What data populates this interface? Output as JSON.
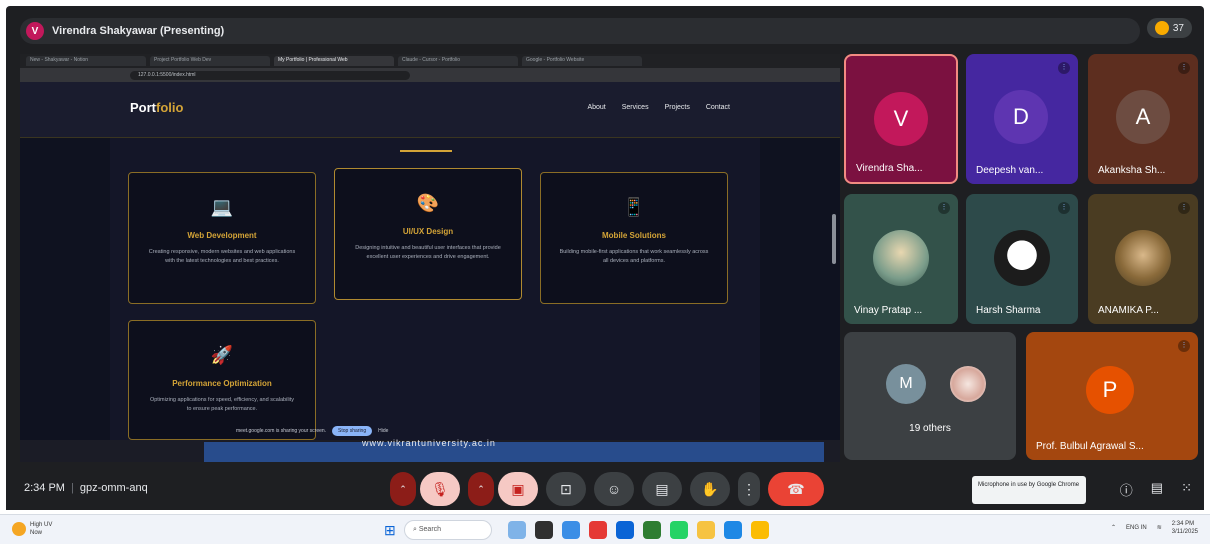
{
  "meet": {
    "presenter_initial": "V",
    "presenter_title": "Virendra Shakyawar (Presenting)",
    "participant_count": "37",
    "time": "2:34 PM",
    "meeting_code": "gpz-omm-anq",
    "mic_toast": "Microphone in use by Google Chrome"
  },
  "shared_screen": {
    "tabs": [
      "New - Shakyawar - Notion",
      "Project Portfolio Web Dev",
      "My Portfolio | Professional Web",
      "Claude - Cursor - Portfolio",
      "Google - Portfolio Website"
    ],
    "address": "127.0.0.1:5500/index.html",
    "site": {
      "logo_accent": "Port",
      "logo_rest": "folio",
      "nav": [
        "About",
        "Services",
        "Projects",
        "Contact"
      ],
      "cards": [
        {
          "icon": "laptop-icon",
          "glyph": "💻",
          "title": "Web Development",
          "desc": "Creating responsive, modern websites and web applications with the latest technologies and best practices."
        },
        {
          "icon": "palette-icon",
          "glyph": "🎨",
          "title": "UI/UX Design",
          "desc": "Designing intuitive and beautiful user interfaces that provide excellent user experiences and drive engagement."
        },
        {
          "icon": "phone-icon",
          "glyph": "📱",
          "title": "Mobile Solutions",
          "desc": "Building mobile-first applications that work seamlessly across all devices and platforms."
        },
        {
          "icon": "rocket-icon",
          "glyph": "🚀",
          "title": "Performance Optimization",
          "desc": "Optimizing applications for speed, efficiency, and scalability to ensure peak performance."
        }
      ]
    },
    "share_strip_text": "meet.google.com is sharing your screen.",
    "stop_sharing": "Stop sharing",
    "hide": "Hide",
    "url_overlay": "www.vikrantuniversity.ac.in"
  },
  "participants": [
    {
      "initial": "V",
      "name": "Virendra Sha...",
      "color": "#c2185b",
      "tile": "#7b1140"
    },
    {
      "initial": "D",
      "name": "Deepesh van...",
      "color": "#5e35b1",
      "tile": "#4527a0"
    },
    {
      "initial": "A",
      "name": "Akanksha Sh...",
      "color": "#6d4c41",
      "tile": "#5d2e1f"
    },
    {
      "name": "Vinay Pratap ...",
      "tile": "#33524a"
    },
    {
      "name": "Harsh Sharma",
      "tile": "#2d4a4a"
    },
    {
      "name": "ANAMIKA P...",
      "tile": "#4a3c22"
    },
    {
      "initial": "M",
      "name": "19 others",
      "tile": "#3c4043"
    },
    {
      "initial": "P",
      "name": "Prof. Bulbul Agrawal S...",
      "color": "#e65100",
      "tile": "#a4470f"
    }
  ],
  "taskbar": {
    "weather_temp": "High UV",
    "weather_sub": "Now",
    "search": "Search",
    "lang": "ENG IN",
    "time": "2:34 PM",
    "date": "3/11/2025"
  }
}
